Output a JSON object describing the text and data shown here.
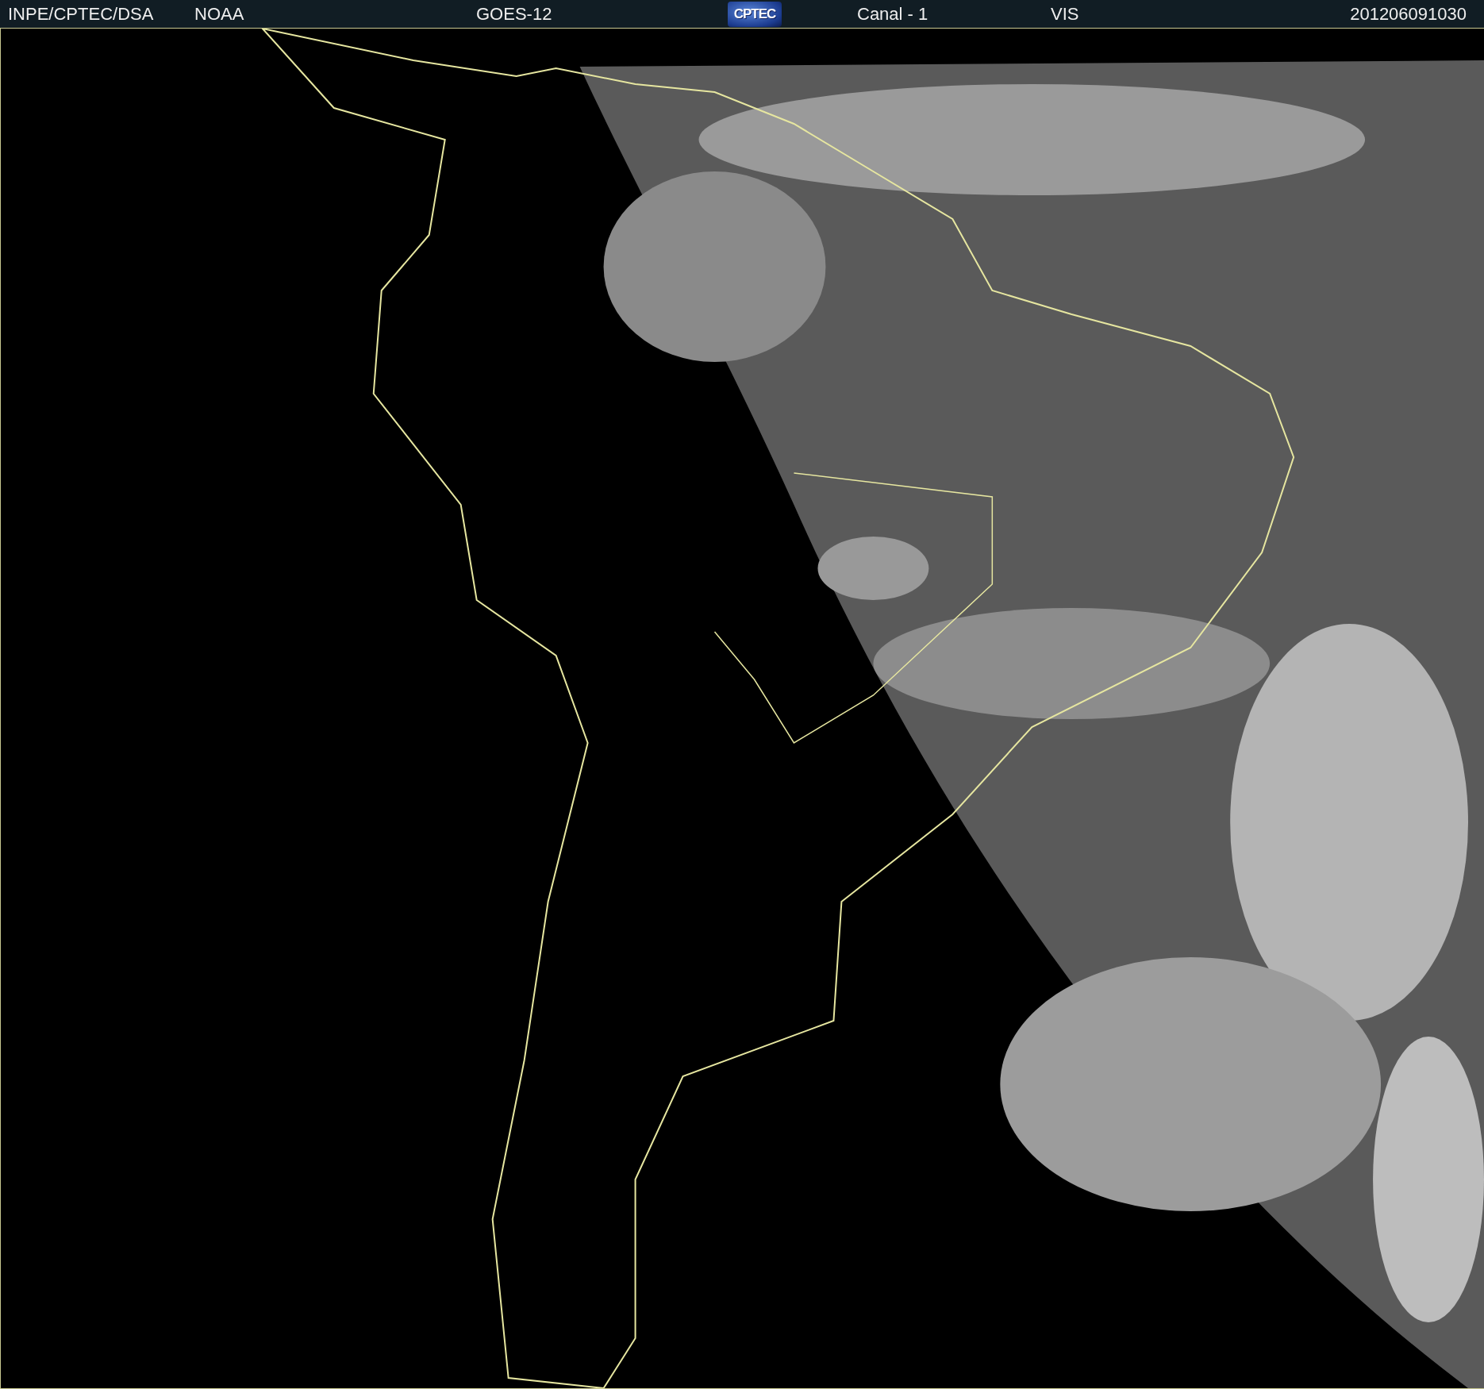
{
  "header": {
    "labels": [
      "INPE/CPTEC/DSA",
      "NOAA",
      "GOES-12"
    ],
    "logo": "CPTEC",
    "channel": "Canal - 1",
    "band": "VIS",
    "timestamp": "201206091030"
  }
}
